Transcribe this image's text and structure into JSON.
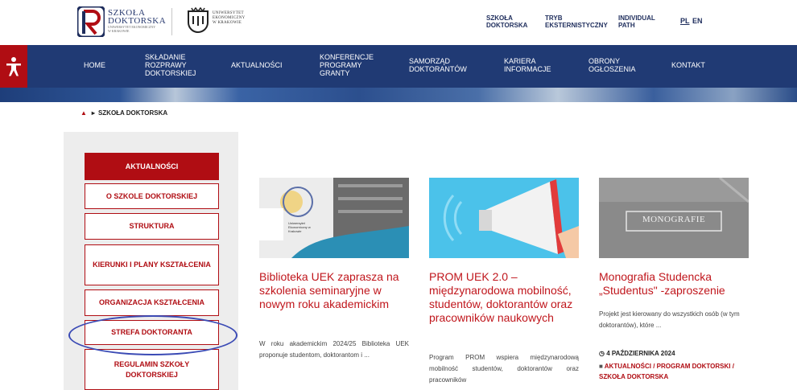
{
  "header": {
    "logo1": {
      "line1": "SZKOŁA",
      "line2": "DOKTORSKA",
      "tag1": "UNIWERSYTET EKONOMICZNY",
      "tag2": "W KRAKOWIE"
    },
    "logo2": {
      "line1": "UNIWERSYTET",
      "line2": "EKONOMICZNY",
      "line3": "W KRAKOWIE"
    },
    "links": [
      {
        "line1": "SZKOŁA",
        "line2": "DOKTORSKA"
      },
      {
        "line1": "TRYB",
        "line2": "EKSTERNISTYCZNY"
      },
      {
        "line1": "INDIVIDUAL",
        "line2": "PATH"
      }
    ],
    "lang_pl": "PL",
    "lang_en": "EN"
  },
  "nav": {
    "items": [
      {
        "lines": [
          "HOME"
        ]
      },
      {
        "lines": [
          "SKŁADANIE",
          "ROZPRAWY",
          "DOKTORSKIEJ"
        ]
      },
      {
        "lines": [
          "AKTUALNOŚCI"
        ]
      },
      {
        "lines": [
          "KONFERENCJE",
          "PROGRAMY",
          "GRANTY"
        ]
      },
      {
        "lines": [
          "SAMORZĄD",
          "DOKTORANTÓW"
        ]
      },
      {
        "lines": [
          "KARIERA",
          "INFORMACJE"
        ]
      },
      {
        "lines": [
          "OBRONY",
          "OGŁOSZENIA"
        ]
      },
      {
        "lines": [
          "KONTAKT"
        ]
      }
    ]
  },
  "breadcrumb": {
    "current": "SZKOŁA DOKTORSKA"
  },
  "sidebar": {
    "items": [
      {
        "label": "AKTUALNOŚCI",
        "active": true
      },
      {
        "label": "O SZKOLE DOKTORSKIEJ"
      },
      {
        "label": "STRUKTURA"
      },
      {
        "label": "KIERUNKI I PLANY KSZTAŁCENIA"
      },
      {
        "label": "ORGANIZACJA KSZTAŁCENIA"
      },
      {
        "label": "STREFA DOKTORANTA"
      },
      {
        "label": "REGULAMIN SZKOŁY DOKTORSKIEJ"
      }
    ]
  },
  "cards": [
    {
      "image_text": "Uniwersytet Ekonomiczny w Krakowie",
      "title": "Biblioteka UEK zaprasza na szkolenia seminaryjne w nowym roku akademickim",
      "excerpt": "W roku akademickim 2024/25 Biblioteka UEK proponuje studentom, doktorantom i ..."
    },
    {
      "title": "PROM UEK 2.0 – międzynarodowa mobilność, studentów, doktorantów oraz pracowników naukowych",
      "excerpt": "Program PROM wspiera międzynarodową mobilność studentów, doktorantów oraz pracowników"
    },
    {
      "image_text": "MONOGRAFIE",
      "title": "Monografia Studencka „Studentus\" -zaproszenie",
      "excerpt": "Projekt jest kierowany do wszystkich osób (w tym doktorantów), które ...",
      "date": "4 PAŹDZIERNIKA 2024",
      "categories": "AKTUALNOŚCI / PROGRAM DOKTORSKI / SZKOŁA DOKTORSKA"
    }
  ],
  "colors": {
    "brand_red": "#b00d13",
    "navy": "#203a74"
  }
}
